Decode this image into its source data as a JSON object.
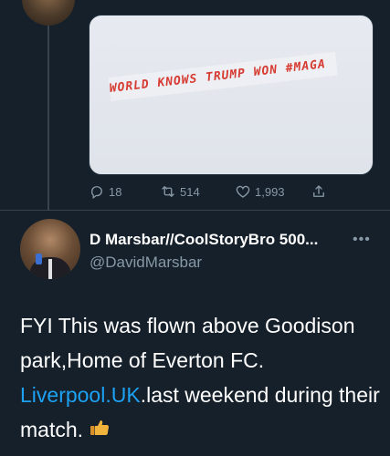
{
  "previous_tweet": {
    "image_banner_text": "WORLD KNOWS TRUMP WON #MAGA",
    "actions": {
      "reply_count": "18",
      "retweet_count": "514",
      "like_count": "1,993"
    }
  },
  "tweet": {
    "display_name": "D Marsbar//CoolStoryBro 500...",
    "handle": "@DavidMarsbar",
    "text_part1": "FYI This was flown above Goodison park,Home of Everton FC. ",
    "link_text": "Liverpool.UK",
    "text_part2": ".last weekend during their match. ",
    "emoji": "thumbs-up"
  },
  "colors": {
    "background": "#15202b",
    "link": "#1da1f2",
    "muted": "#8899a6",
    "banner_text": "#d63a30"
  }
}
